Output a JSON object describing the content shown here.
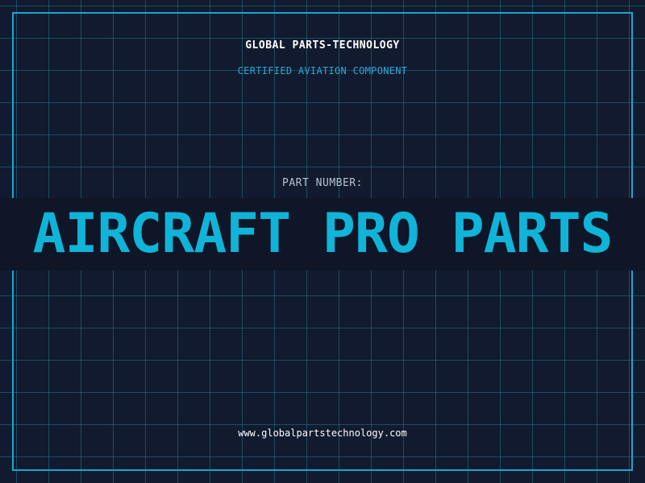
{
  "header": {
    "company": "GLOBAL PARTS-TECHNOLOGY",
    "tagline": "CERTIFIED AVIATION COMPONENT"
  },
  "part": {
    "label": "PART NUMBER:",
    "value": "AIRCRAFT PRO PARTS"
  },
  "footer": {
    "url": "www.globalpartstechnology.com"
  },
  "colors": {
    "background": "#111a2e",
    "grid": "#23788c",
    "frame": "#1aa6cf",
    "accent": "#0fb4d8",
    "banner": "#0e1628"
  }
}
